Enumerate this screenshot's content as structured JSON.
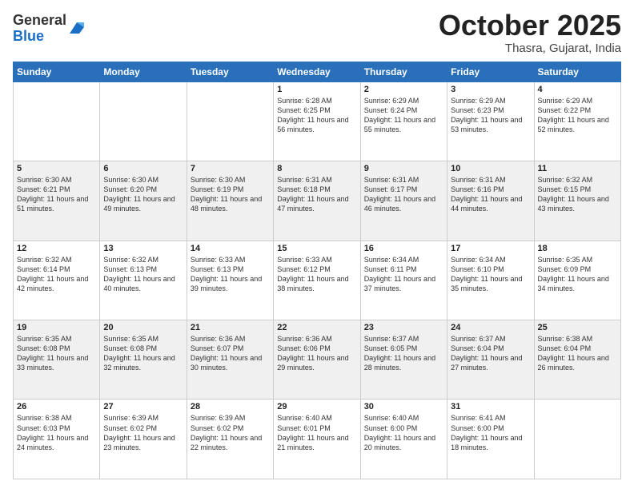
{
  "header": {
    "logo_general": "General",
    "logo_blue": "Blue",
    "month": "October 2025",
    "location": "Thasra, Gujarat, India"
  },
  "days_of_week": [
    "Sunday",
    "Monday",
    "Tuesday",
    "Wednesday",
    "Thursday",
    "Friday",
    "Saturday"
  ],
  "weeks": [
    {
      "days": [
        {
          "num": "",
          "info": ""
        },
        {
          "num": "",
          "info": ""
        },
        {
          "num": "",
          "info": ""
        },
        {
          "num": "1",
          "info": "Sunrise: 6:28 AM\nSunset: 6:25 PM\nDaylight: 11 hours and 56 minutes."
        },
        {
          "num": "2",
          "info": "Sunrise: 6:29 AM\nSunset: 6:24 PM\nDaylight: 11 hours and 55 minutes."
        },
        {
          "num": "3",
          "info": "Sunrise: 6:29 AM\nSunset: 6:23 PM\nDaylight: 11 hours and 53 minutes."
        },
        {
          "num": "4",
          "info": "Sunrise: 6:29 AM\nSunset: 6:22 PM\nDaylight: 11 hours and 52 minutes."
        }
      ]
    },
    {
      "days": [
        {
          "num": "5",
          "info": "Sunrise: 6:30 AM\nSunset: 6:21 PM\nDaylight: 11 hours and 51 minutes."
        },
        {
          "num": "6",
          "info": "Sunrise: 6:30 AM\nSunset: 6:20 PM\nDaylight: 11 hours and 49 minutes."
        },
        {
          "num": "7",
          "info": "Sunrise: 6:30 AM\nSunset: 6:19 PM\nDaylight: 11 hours and 48 minutes."
        },
        {
          "num": "8",
          "info": "Sunrise: 6:31 AM\nSunset: 6:18 PM\nDaylight: 11 hours and 47 minutes."
        },
        {
          "num": "9",
          "info": "Sunrise: 6:31 AM\nSunset: 6:17 PM\nDaylight: 11 hours and 46 minutes."
        },
        {
          "num": "10",
          "info": "Sunrise: 6:31 AM\nSunset: 6:16 PM\nDaylight: 11 hours and 44 minutes."
        },
        {
          "num": "11",
          "info": "Sunrise: 6:32 AM\nSunset: 6:15 PM\nDaylight: 11 hours and 43 minutes."
        }
      ]
    },
    {
      "days": [
        {
          "num": "12",
          "info": "Sunrise: 6:32 AM\nSunset: 6:14 PM\nDaylight: 11 hours and 42 minutes."
        },
        {
          "num": "13",
          "info": "Sunrise: 6:32 AM\nSunset: 6:13 PM\nDaylight: 11 hours and 40 minutes."
        },
        {
          "num": "14",
          "info": "Sunrise: 6:33 AM\nSunset: 6:13 PM\nDaylight: 11 hours and 39 minutes."
        },
        {
          "num": "15",
          "info": "Sunrise: 6:33 AM\nSunset: 6:12 PM\nDaylight: 11 hours and 38 minutes."
        },
        {
          "num": "16",
          "info": "Sunrise: 6:34 AM\nSunset: 6:11 PM\nDaylight: 11 hours and 37 minutes."
        },
        {
          "num": "17",
          "info": "Sunrise: 6:34 AM\nSunset: 6:10 PM\nDaylight: 11 hours and 35 minutes."
        },
        {
          "num": "18",
          "info": "Sunrise: 6:35 AM\nSunset: 6:09 PM\nDaylight: 11 hours and 34 minutes."
        }
      ]
    },
    {
      "days": [
        {
          "num": "19",
          "info": "Sunrise: 6:35 AM\nSunset: 6:08 PM\nDaylight: 11 hours and 33 minutes."
        },
        {
          "num": "20",
          "info": "Sunrise: 6:35 AM\nSunset: 6:08 PM\nDaylight: 11 hours and 32 minutes."
        },
        {
          "num": "21",
          "info": "Sunrise: 6:36 AM\nSunset: 6:07 PM\nDaylight: 11 hours and 30 minutes."
        },
        {
          "num": "22",
          "info": "Sunrise: 6:36 AM\nSunset: 6:06 PM\nDaylight: 11 hours and 29 minutes."
        },
        {
          "num": "23",
          "info": "Sunrise: 6:37 AM\nSunset: 6:05 PM\nDaylight: 11 hours and 28 minutes."
        },
        {
          "num": "24",
          "info": "Sunrise: 6:37 AM\nSunset: 6:04 PM\nDaylight: 11 hours and 27 minutes."
        },
        {
          "num": "25",
          "info": "Sunrise: 6:38 AM\nSunset: 6:04 PM\nDaylight: 11 hours and 26 minutes."
        }
      ]
    },
    {
      "days": [
        {
          "num": "26",
          "info": "Sunrise: 6:38 AM\nSunset: 6:03 PM\nDaylight: 11 hours and 24 minutes."
        },
        {
          "num": "27",
          "info": "Sunrise: 6:39 AM\nSunset: 6:02 PM\nDaylight: 11 hours and 23 minutes."
        },
        {
          "num": "28",
          "info": "Sunrise: 6:39 AM\nSunset: 6:02 PM\nDaylight: 11 hours and 22 minutes."
        },
        {
          "num": "29",
          "info": "Sunrise: 6:40 AM\nSunset: 6:01 PM\nDaylight: 11 hours and 21 minutes."
        },
        {
          "num": "30",
          "info": "Sunrise: 6:40 AM\nSunset: 6:00 PM\nDaylight: 11 hours and 20 minutes."
        },
        {
          "num": "31",
          "info": "Sunrise: 6:41 AM\nSunset: 6:00 PM\nDaylight: 11 hours and 18 minutes."
        },
        {
          "num": "",
          "info": ""
        }
      ]
    }
  ]
}
